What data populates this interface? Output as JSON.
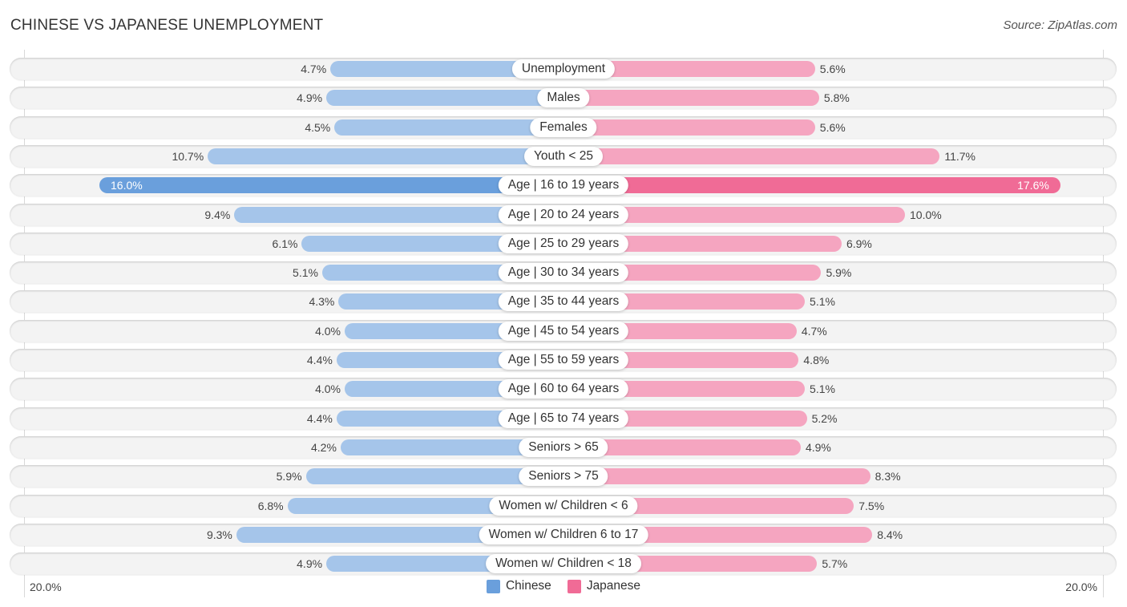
{
  "title": "CHINESE VS JAPANESE UNEMPLOYMENT",
  "source": "Source: ZipAtlas.com",
  "colors": {
    "chinese": "#a5c5ea",
    "chinese_highlight": "#6a9fdc",
    "japanese": "#f5a5c0",
    "japanese_highlight": "#f06b96"
  },
  "axis": {
    "left_label": "20.0%",
    "right_label": "20.0%"
  },
  "legend": [
    {
      "label": "Chinese",
      "color": "#6a9fdc"
    },
    {
      "label": "Japanese",
      "color": "#f06b96"
    }
  ],
  "chart_data": {
    "type": "bar",
    "orientation": "horizontal-diverging",
    "title": "CHINESE VS JAPANESE UNEMPLOYMENT",
    "xlabel": "",
    "ylabel": "",
    "xlim": [
      -20,
      20
    ],
    "unit": "%",
    "legend_position": "bottom-center",
    "categories": [
      "Unemployment",
      "Males",
      "Females",
      "Youth < 25",
      "Age | 16 to 19 years",
      "Age | 20 to 24 years",
      "Age | 25 to 29 years",
      "Age | 30 to 34 years",
      "Age | 35 to 44 years",
      "Age | 45 to 54 years",
      "Age | 55 to 59 years",
      "Age | 60 to 64 years",
      "Age | 65 to 74 years",
      "Seniors > 65",
      "Seniors > 75",
      "Women w/ Children < 6",
      "Women w/ Children 6 to 17",
      "Women w/ Children < 18"
    ],
    "series": [
      {
        "name": "Chinese",
        "side": "left",
        "values": [
          4.7,
          4.9,
          4.5,
          10.7,
          16.0,
          9.4,
          6.1,
          5.1,
          4.3,
          4.0,
          4.4,
          4.0,
          4.4,
          4.2,
          5.9,
          6.8,
          9.3,
          4.9
        ],
        "labels": [
          "4.7%",
          "4.9%",
          "4.5%",
          "10.7%",
          "16.0%",
          "9.4%",
          "6.1%",
          "5.1%",
          "4.3%",
          "4.0%",
          "4.4%",
          "4.0%",
          "4.4%",
          "4.2%",
          "5.9%",
          "6.8%",
          "9.3%",
          "4.9%"
        ]
      },
      {
        "name": "Japanese",
        "side": "right",
        "values": [
          5.6,
          5.8,
          5.6,
          11.7,
          17.6,
          10.0,
          6.9,
          5.9,
          5.1,
          4.7,
          4.8,
          5.1,
          5.2,
          4.9,
          8.3,
          7.5,
          8.4,
          5.7
        ],
        "labels": [
          "5.6%",
          "5.8%",
          "5.6%",
          "11.7%",
          "17.6%",
          "10.0%",
          "6.9%",
          "5.9%",
          "5.1%",
          "4.7%",
          "4.8%",
          "5.1%",
          "5.2%",
          "4.9%",
          "8.3%",
          "7.5%",
          "8.4%",
          "5.7%"
        ]
      }
    ],
    "highlighted_category": "Age | 16 to 19 years"
  }
}
